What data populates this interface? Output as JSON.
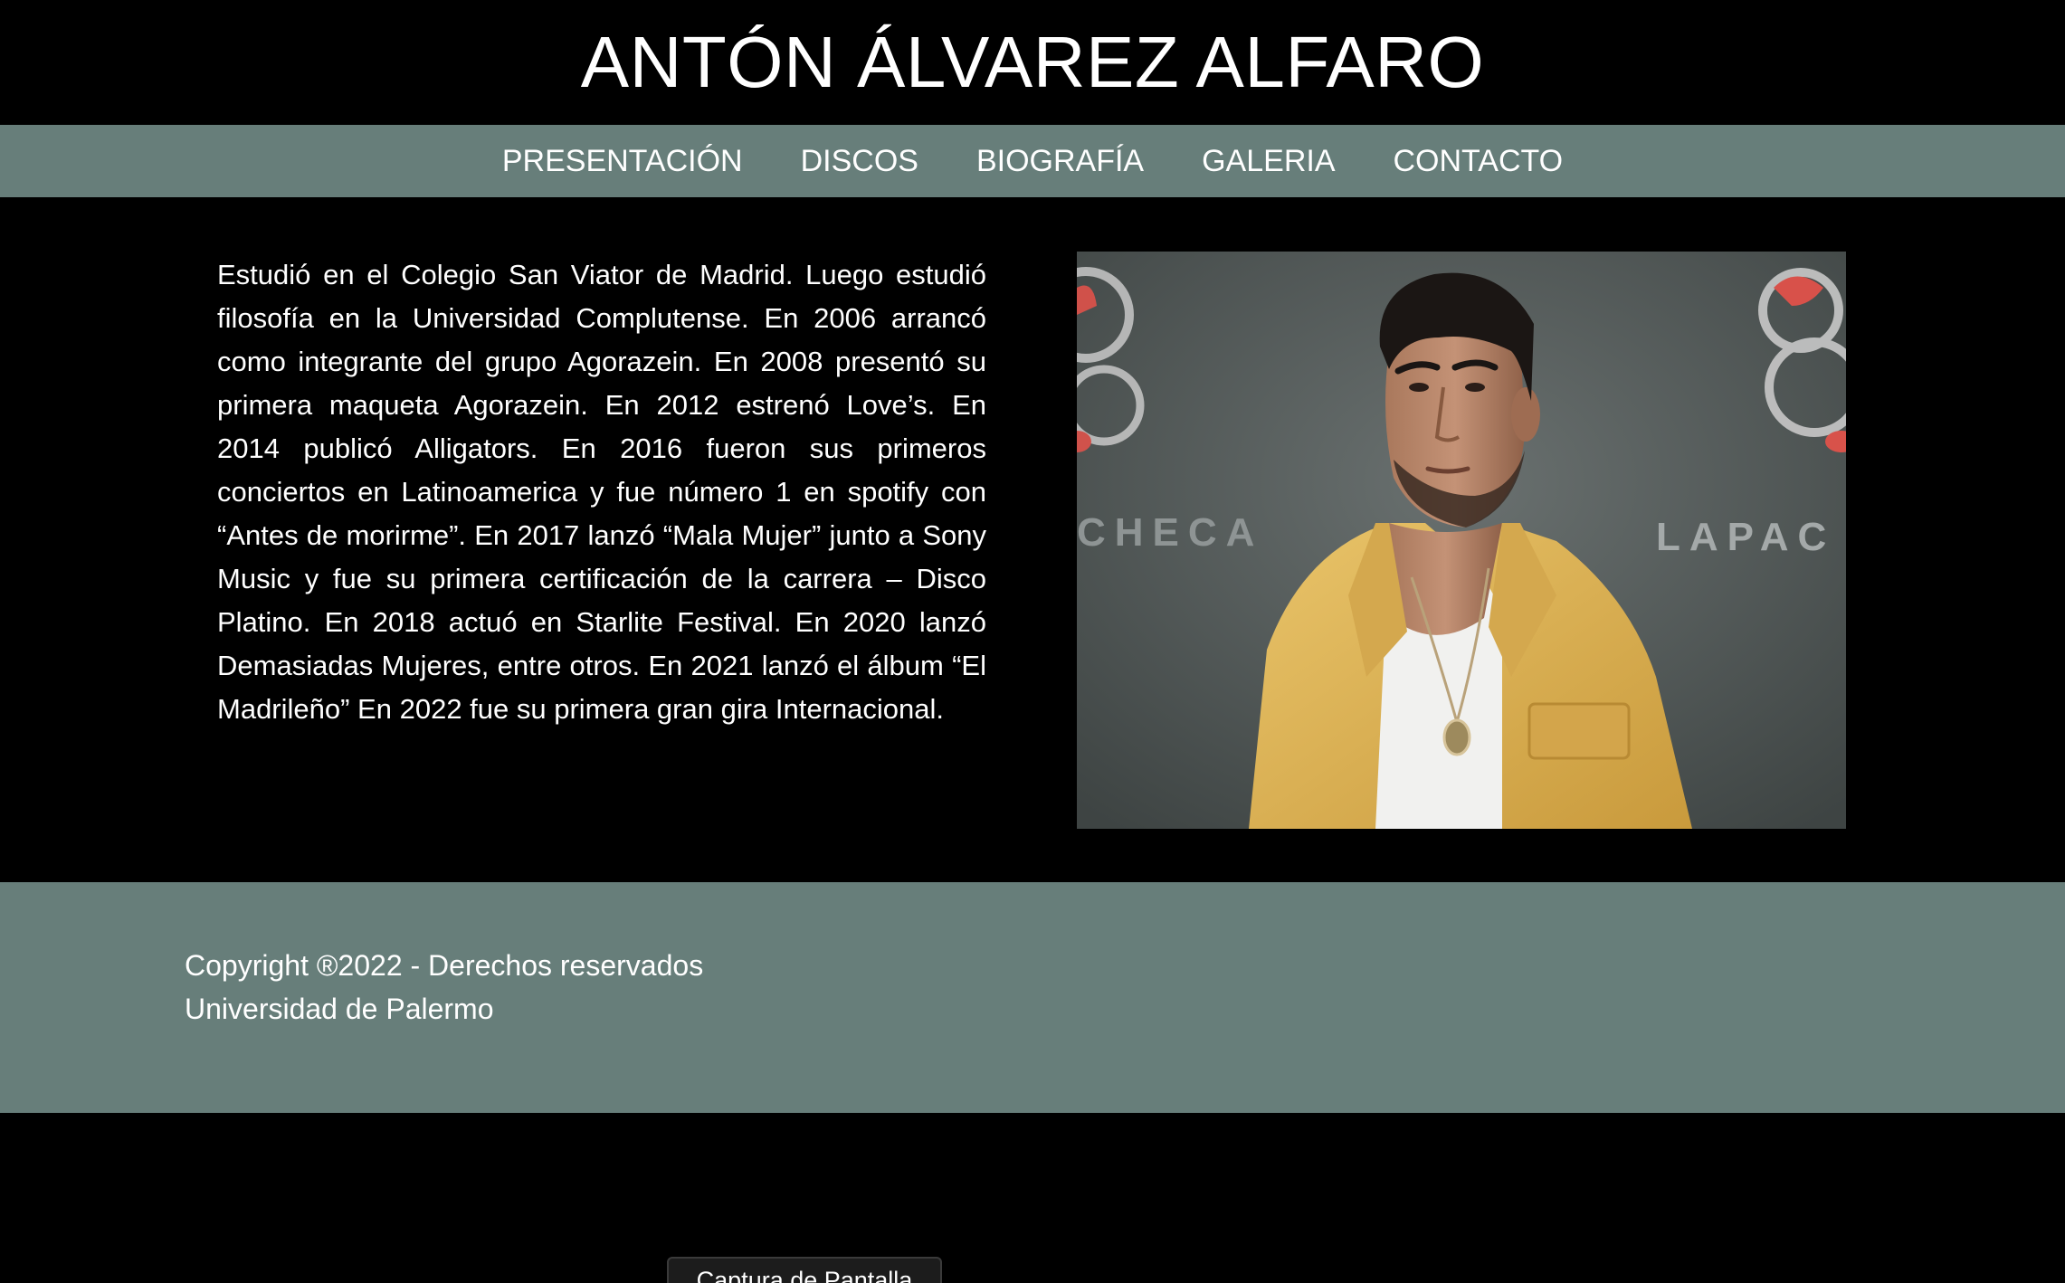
{
  "header": {
    "title": "ANTÓN ÁLVAREZ ALFARO"
  },
  "nav": {
    "items": [
      {
        "label": "PRESENTACIÓN"
      },
      {
        "label": "DISCOS"
      },
      {
        "label": "BIOGRAFÍA"
      },
      {
        "label": "GALERIA"
      },
      {
        "label": "CONTACTO"
      }
    ]
  },
  "main": {
    "biography": "Estudió en el Colegio San Viator de Madrid. Luego estudió filosofía en la Universidad Complutense. En 2006 arrancó como integrante del grupo Agorazein. En 2008 presentó su primera maqueta Agorazein. En 2012 estrenó Love’s. En 2014 publicó Alligators. En 2016 fueron sus primeros conciertos en Latinoamerica y fue número 1 en spotify con “Antes de morirme”. En 2017 lanzó “Mala Mujer” junto a Sony Music y fue su primera certificación de la carrera – Disco Platino. En 2018 actuó en Starlite Festival. En 2020 lanzó Demasiadas Mujeres, entre otros. En 2021 lanzó el álbum “El Madrileño” En 2022 fue su primera gran gira Internacional.",
    "photo": {
      "backdrop_text_left": "CHECA",
      "backdrop_text_right": "LAPAC"
    }
  },
  "footer": {
    "copyright": "Copyright ®2022 - Derechos reservados",
    "institution": "Universidad de Palermo"
  },
  "overlay": {
    "caption": "Captura de Pantalla"
  },
  "colors": {
    "background": "#000000",
    "bar": "#677e7a",
    "text": "#ffffff",
    "jacket": "#e2b95a",
    "backdrop": "#5a6160",
    "logo_red": "#e8524a"
  }
}
